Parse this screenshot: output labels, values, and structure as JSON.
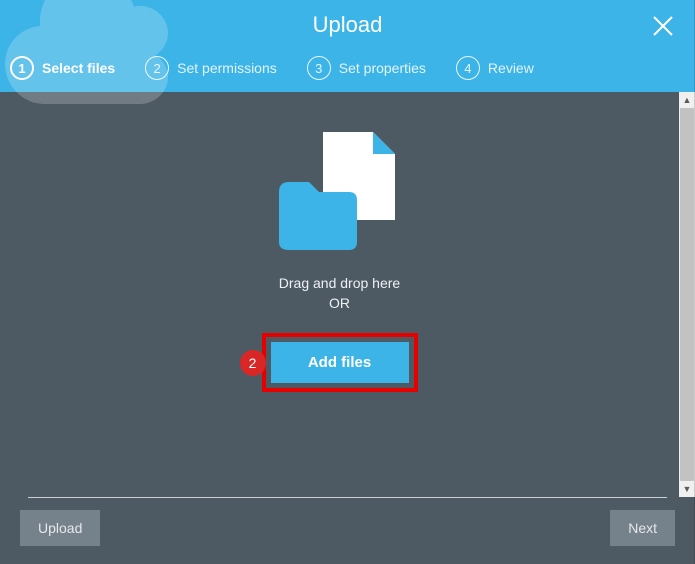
{
  "header": {
    "title": "Upload"
  },
  "steps": [
    {
      "num": "1",
      "label": "Select files",
      "active": true
    },
    {
      "num": "2",
      "label": "Set permissions",
      "active": false
    },
    {
      "num": "3",
      "label": "Set properties",
      "active": false
    },
    {
      "num": "4",
      "label": "Review",
      "active": false
    }
  ],
  "dropzone": {
    "line1": "Drag and drop here",
    "line2": "OR",
    "button_label": "Add files"
  },
  "annotation": {
    "badge": "2"
  },
  "footer": {
    "upload_label": "Upload",
    "next_label": "Next"
  }
}
